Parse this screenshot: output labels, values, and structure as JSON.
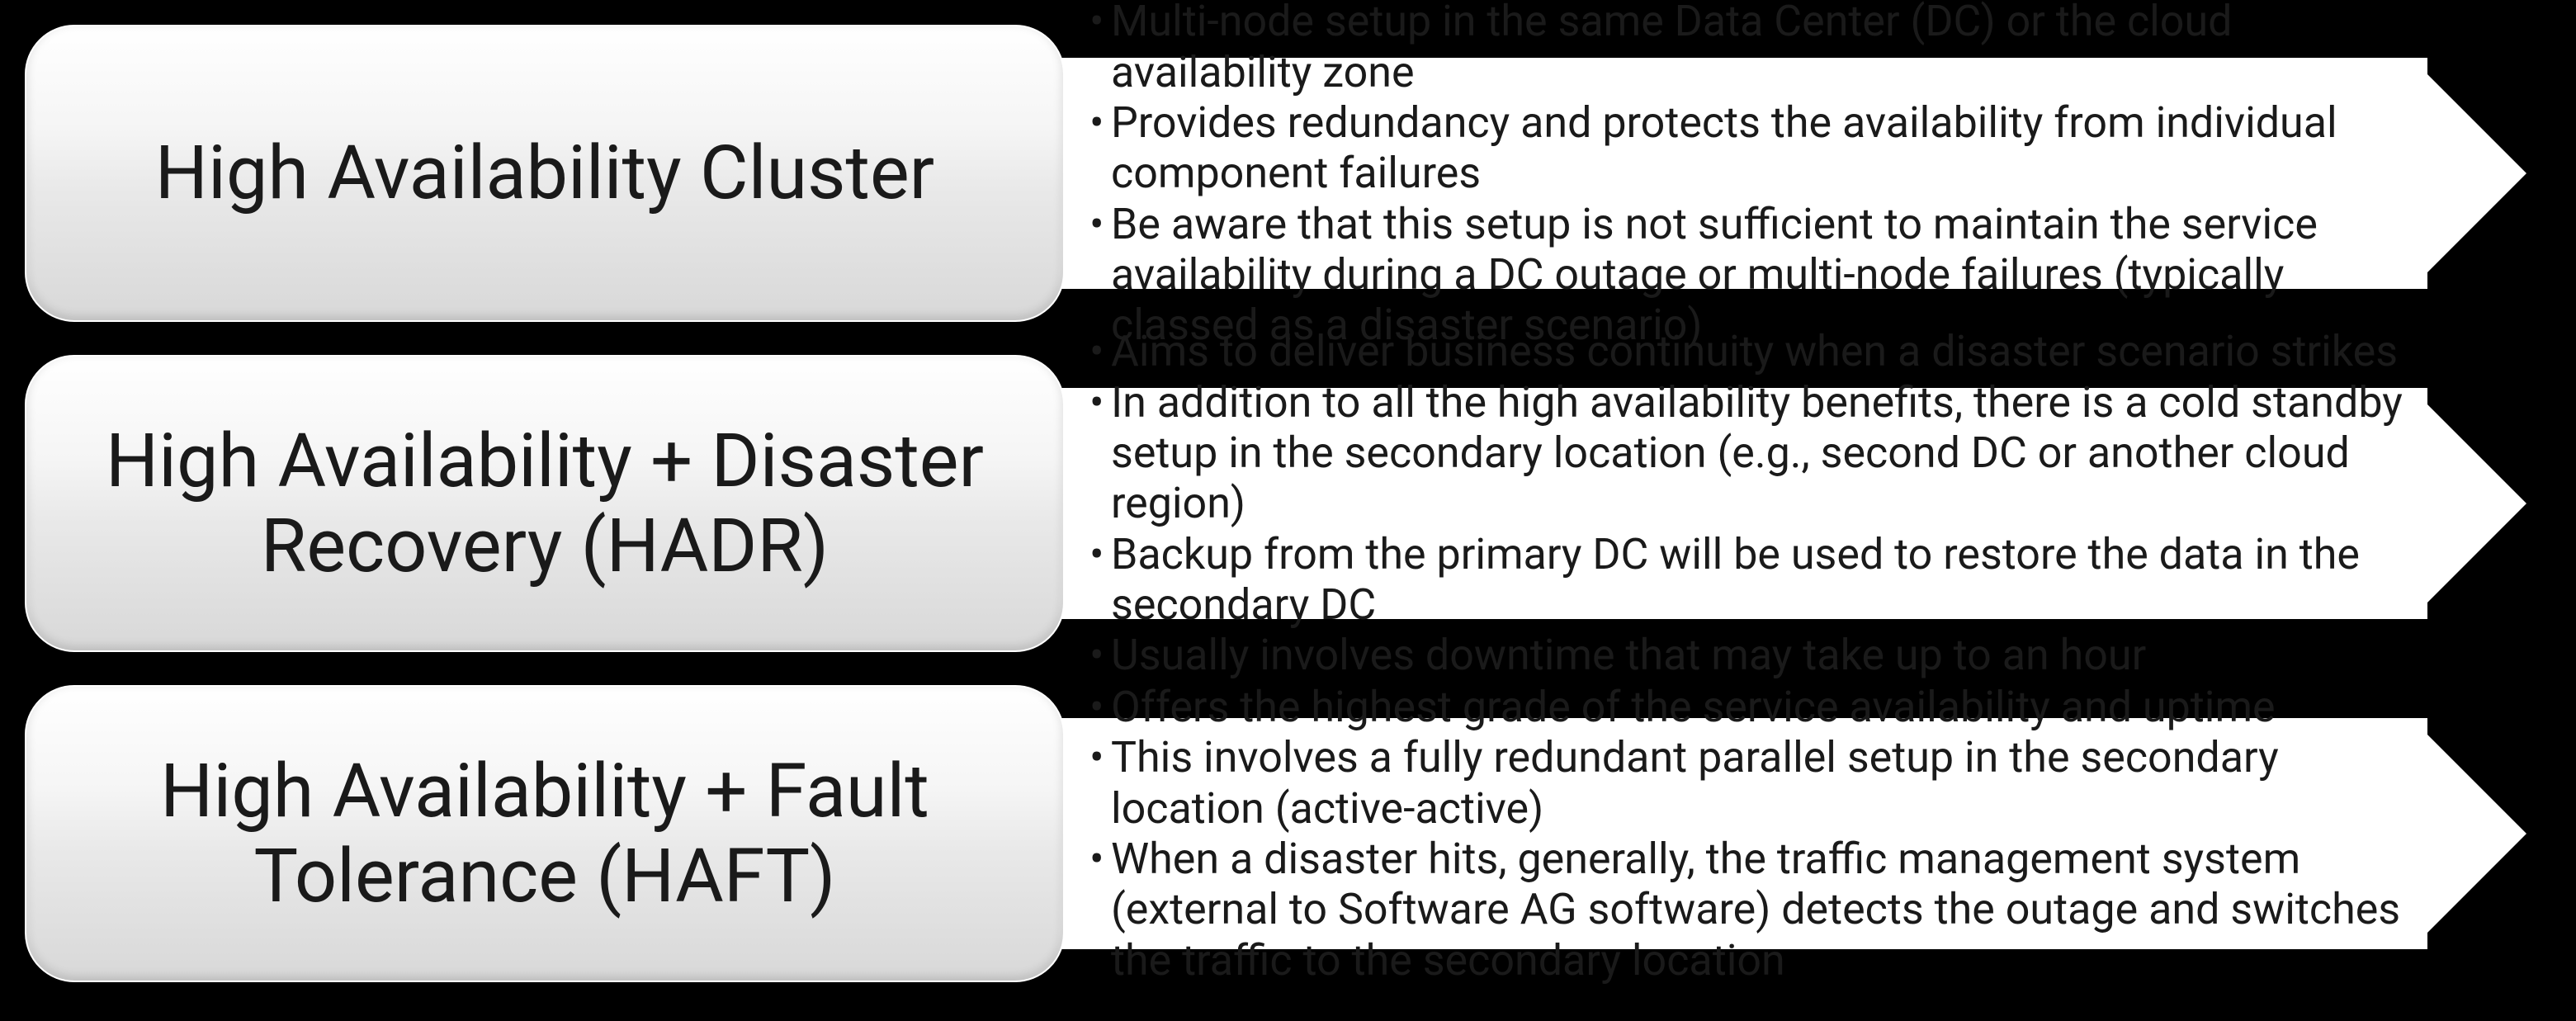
{
  "rows": [
    {
      "title": "High Availability Cluster",
      "bullets": [
        "Multi-node setup in the same Data Center (DC) or the cloud availability zone",
        "Provides redundancy and protects the availability from individual component failures",
        "Be aware that this setup is not sufficient to maintain the service availability during a DC outage or multi-node failures (typically classed as a disaster scenario)"
      ]
    },
    {
      "title": "High Availability + Disaster Recovery (HADR)",
      "bullets": [
        "Aims to deliver business continuity when a disaster scenario strikes",
        "In addition to all the high availability benefits, there is a cold standby setup in the secondary location (e.g., second DC or another cloud region)",
        "Backup from the primary DC will be used to restore the data in the secondary DC",
        "Usually involves downtime that may take up to an hour"
      ]
    },
    {
      "title": "High Availability + Fault Tolerance (HAFT)",
      "bullets": [
        "Offers the highest grade of the service availability and uptime",
        "This involves a fully redundant parallel setup in the secondary location (active-active)",
        "When a disaster hits, generally, the traffic management system (external to Software AG software) detects the outage and switches the traffic to the secondary location"
      ]
    }
  ]
}
